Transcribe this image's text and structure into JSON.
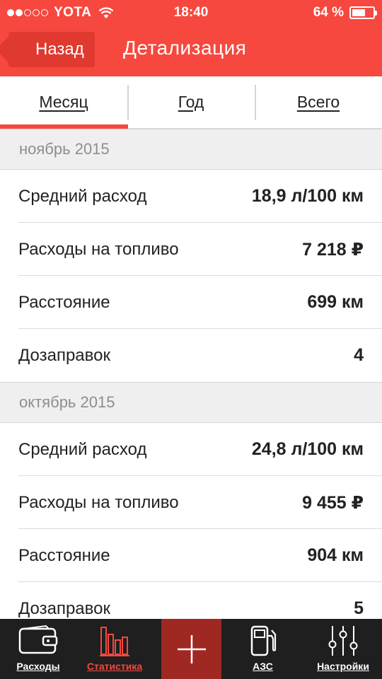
{
  "status_bar": {
    "carrier": "YOTA",
    "time": "18:40",
    "battery_text": "64 %",
    "battery_level": 0.64,
    "signal_bars": 2,
    "signal_total": 5
  },
  "nav": {
    "back_label": "Назад",
    "title": "Детализация"
  },
  "tabs": [
    {
      "label": "Месяц",
      "active": true
    },
    {
      "label": "Год",
      "active": false
    },
    {
      "label": "Всего",
      "active": false
    }
  ],
  "sections": [
    {
      "title": "ноябрь 2015",
      "rows": [
        {
          "label": "Средний расход",
          "value": "18,9 л/100 км"
        },
        {
          "label": "Расходы на топливо",
          "value": "7 218 ₽"
        },
        {
          "label": "Расстояние",
          "value": "699 км"
        },
        {
          "label": "Дозаправок",
          "value": "4"
        }
      ]
    },
    {
      "title": "октябрь 2015",
      "rows": [
        {
          "label": "Средний расход",
          "value": "24,8 л/100 км"
        },
        {
          "label": "Расходы на топливо",
          "value": "9 455 ₽"
        },
        {
          "label": "Расстояние",
          "value": "904 км"
        },
        {
          "label": "Дозаправок",
          "value": "5"
        }
      ]
    }
  ],
  "tabbar": [
    {
      "label": "Расходы",
      "icon": "wallet-icon",
      "active": false
    },
    {
      "label": "Статистика",
      "icon": "bar-chart-icon",
      "active": true
    },
    {
      "label": "",
      "icon": "plus-icon",
      "active": false
    },
    {
      "label": "АЗС",
      "icon": "fuel-pump-icon",
      "active": false
    },
    {
      "label": "Настройки",
      "icon": "sliders-icon",
      "active": false
    }
  ],
  "colors": {
    "accent": "#f6483f",
    "accent_dark": "#e0392f",
    "tabbar_bg": "#1f1f1f",
    "add_button_bg": "#a02822"
  }
}
